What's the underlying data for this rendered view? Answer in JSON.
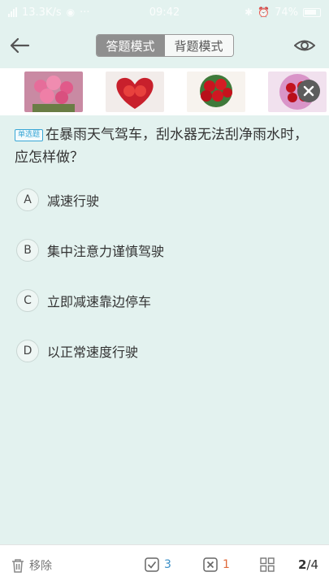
{
  "status_bar": {
    "speed": "13.3K/s",
    "time": "09:42",
    "battery": "74%"
  },
  "nav": {
    "mode_answer": "答题模式",
    "mode_memorize": "背题模式"
  },
  "ad": {
    "thumbs": [
      "bouquet-pink",
      "bouquet-heart",
      "bouquet-red",
      "bouquet-purple"
    ]
  },
  "question": {
    "type_tag": "单选题",
    "text": "在暴雨天气驾车，刮水器无法刮净雨水时，应怎样做？",
    "options": [
      {
        "letter": "A",
        "text": "减速行驶"
      },
      {
        "letter": "B",
        "text": "集中注意力谨慎驾驶"
      },
      {
        "letter": "C",
        "text": "立即减速靠边停车"
      },
      {
        "letter": "D",
        "text": "以正常速度行驶"
      }
    ]
  },
  "bottom": {
    "remove_label": "移除",
    "correct_count": "3",
    "wrong_count": "1",
    "current": "2",
    "total": "/4"
  },
  "colors": {
    "background": "#e3f2ef",
    "correct": "#3a8fc7",
    "wrong": "#e06a3b"
  }
}
